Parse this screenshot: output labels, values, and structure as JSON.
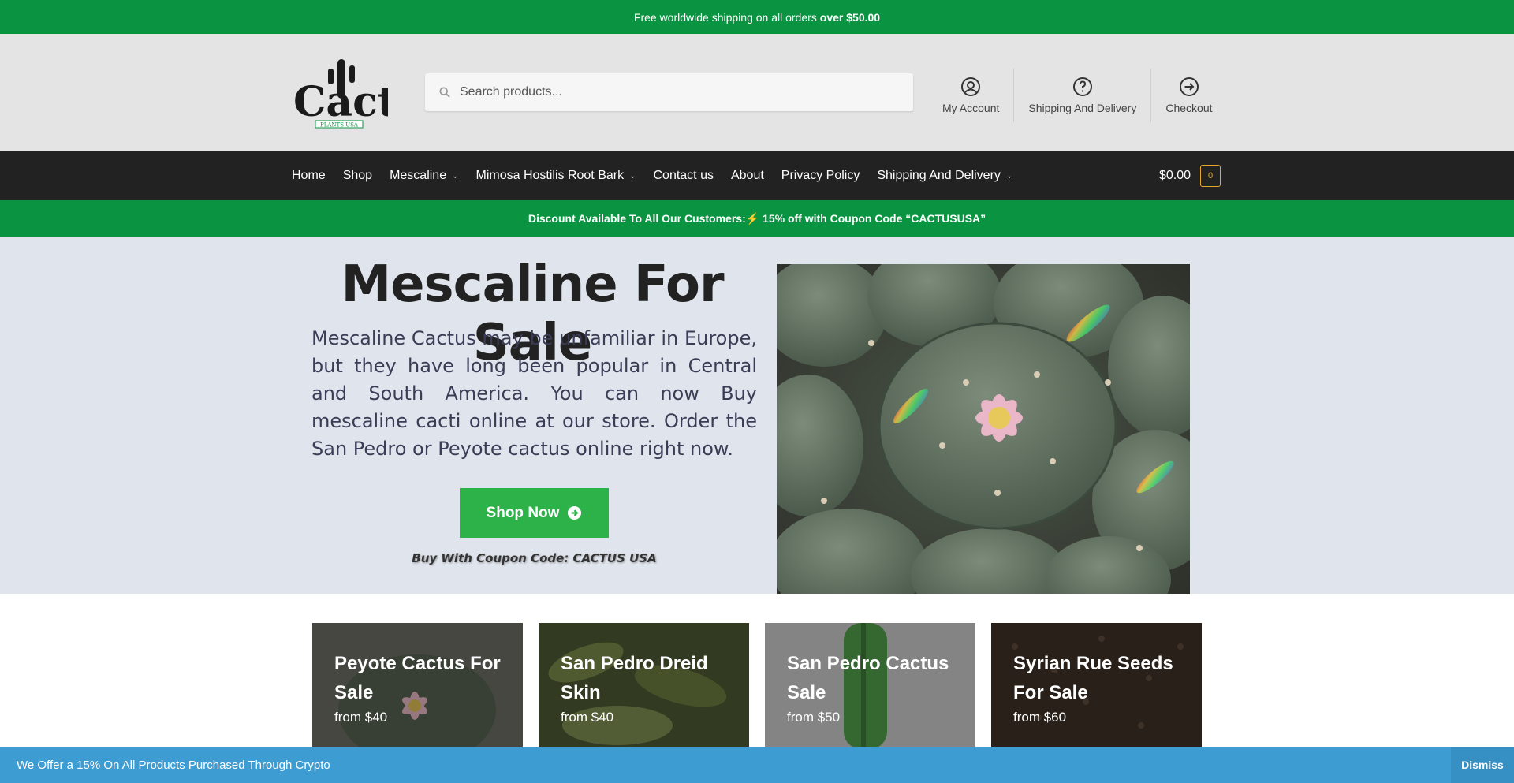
{
  "topbar": {
    "text": "Free worldwide shipping on all orders",
    "bold": "over $50.00"
  },
  "header": {
    "logo_text": "Cactus",
    "logo_subtext": "PLANTS USA",
    "search_placeholder": "Search products...",
    "links": [
      {
        "label": "My Account",
        "icon": "user-circle-icon"
      },
      {
        "label": "Shipping And Delivery",
        "icon": "question-circle-icon"
      },
      {
        "label": "Checkout",
        "icon": "arrow-circle-icon"
      }
    ]
  },
  "nav": {
    "items": [
      {
        "label": "Home",
        "dropdown": false
      },
      {
        "label": "Shop",
        "dropdown": false
      },
      {
        "label": "Mescaline",
        "dropdown": true
      },
      {
        "label": "Mimosa Hostilis Root Bark",
        "dropdown": true
      },
      {
        "label": "Contact us",
        "dropdown": false
      },
      {
        "label": "About",
        "dropdown": false
      },
      {
        "label": "Privacy Policy",
        "dropdown": false
      },
      {
        "label": "Shipping And Delivery",
        "dropdown": true
      }
    ],
    "cart_total": "$0.00",
    "cart_count": "0"
  },
  "discount": {
    "text": "Discount Available To All Our Customers:⚡ 15% off with Coupon Code “CACTUSUSA”"
  },
  "hero": {
    "title": "Mescaline For Sale",
    "body": "Mescaline Cactus may be unfamiliar in Europe, but they have long been popular in Central and South America. You can now Buy mescaline cacti online at our store. Order the San Pedro or Peyote cactus online right now.",
    "button": "Shop Now",
    "coupon": "Buy With Coupon Code: CACTUS USA"
  },
  "products": [
    {
      "title": "Peyote Cactus For Sale",
      "price": "from $40"
    },
    {
      "title": "San Pedro Dreid Skin",
      "price": "from $40"
    },
    {
      "title": "San Pedro Cactus Sale",
      "price": "from $50"
    },
    {
      "title": "Syrian Rue Seeds For Sale",
      "price": "from $60"
    }
  ],
  "notice": {
    "text": "We Offer a 15% On All Products Purchased Through Crypto",
    "dismiss": "Dismiss"
  },
  "colors": {
    "green": "#0a9441",
    "nav_dark": "#222222",
    "button_green": "#2db24a",
    "notice_blue": "#3d9cd2",
    "cart_accent": "#e2a82c"
  }
}
